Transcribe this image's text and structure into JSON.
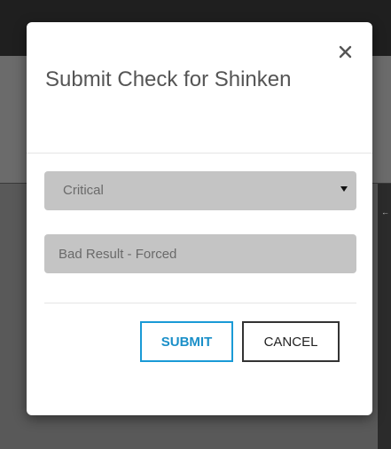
{
  "modal": {
    "title": "Submit Check for Shinken",
    "close_label": "×",
    "status_select": {
      "selected": "Critical"
    },
    "output_field": {
      "value": "Bad Result - Forced"
    },
    "buttons": {
      "submit": "SUBMIT",
      "cancel": "CANCEL"
    }
  },
  "colors": {
    "submit_accent": "#1a9ad6",
    "field_bg": "#c4c4c4",
    "title_text": "#555555"
  },
  "icons": {
    "close": "close-icon",
    "caret": "caret-down-icon"
  }
}
